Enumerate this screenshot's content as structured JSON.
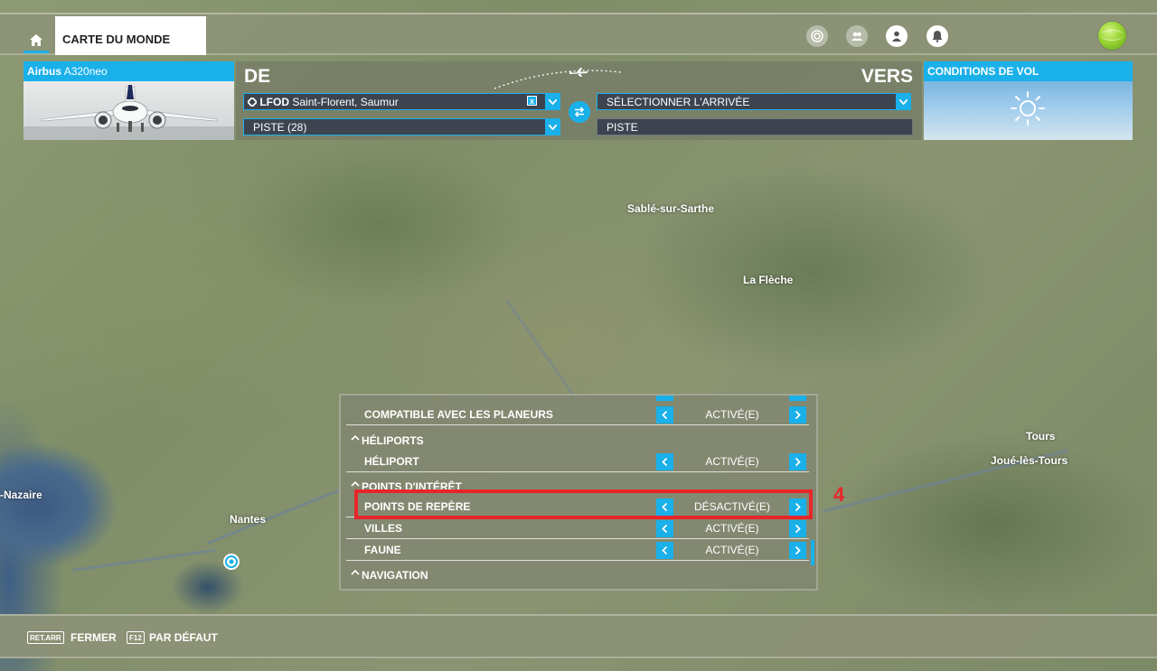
{
  "topbar": {
    "world_map_tab": "CARTE DU MONDE",
    "icons": [
      "home-icon",
      "target-icon",
      "group-icon",
      "profile-icon",
      "notification-icon",
      "globe-icon"
    ]
  },
  "aircraft": {
    "brand": "Airbus",
    "model": "A320neo"
  },
  "route": {
    "from_title": "DE",
    "to_title": "VERS",
    "departure_code": "LFOD",
    "departure_name": "Saint-Florent, Saumur",
    "departure_runway": "PISTE (28)",
    "arrival_placeholder": "SÉLECTIONNER L'ARRIVÉE",
    "arrival_runway": "PISTE"
  },
  "conditions": {
    "title": "CONDITIONS DE VOL",
    "weather_icon": "sun-icon"
  },
  "map": {
    "cities": {
      "sable": "Sablé-sur-Sarthe",
      "la_fleche": "La Flèche",
      "nazaire": "-Nazaire",
      "nantes": "Nantes",
      "tours": "Tours",
      "joue": "Joué-lès-Tours"
    }
  },
  "filters": {
    "rows": [
      {
        "kind": "item",
        "label": "COMPATIBLE AVEC LES PLANEURS",
        "value": "ACTIVÉ(E)"
      },
      {
        "kind": "header",
        "label": "HÉLIPORTS"
      },
      {
        "kind": "item",
        "label": "HÉLIPORT",
        "value": "ACTIVÉ(E)"
      },
      {
        "kind": "header",
        "label": "POINTS D'INTÉRÊT"
      },
      {
        "kind": "item",
        "label": "POINTS DE REPÈRE",
        "value": "DÉSACTIVÉ(E)"
      },
      {
        "kind": "item",
        "label": "VILLES",
        "value": "ACTIVÉ(E)"
      },
      {
        "kind": "item",
        "label": "FAUNE",
        "value": "ACTIVÉ(E)"
      },
      {
        "kind": "header",
        "label": "NAVIGATION"
      }
    ]
  },
  "annotation": {
    "step_number": "4",
    "highlight_color": "#e8252a"
  },
  "bottombar": {
    "close_key": "RET.ARR",
    "close_label": "FERMER",
    "default_key": "F12",
    "default_label": "PAR DÉFAUT"
  },
  "colors": {
    "accent": "#1ab0ea",
    "panel": "#82886f",
    "field": "#3d4450"
  }
}
